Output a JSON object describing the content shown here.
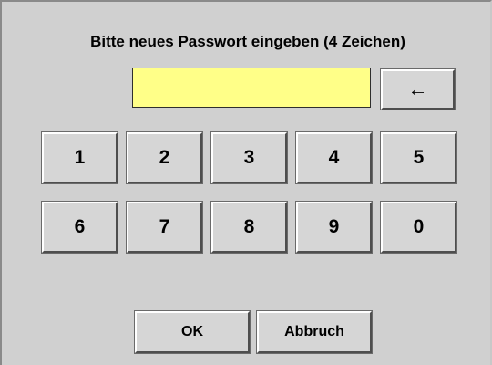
{
  "dialog": {
    "title": "Bitte neues Passwort eingeben (4 Zeichen)",
    "password_value": "",
    "backspace_label": "←"
  },
  "keypad": {
    "row1": [
      "1",
      "2",
      "3",
      "4",
      "5"
    ],
    "row2": [
      "6",
      "7",
      "8",
      "9",
      "0"
    ]
  },
  "actions": {
    "ok_label": "OK",
    "cancel_label": "Abbruch"
  },
  "colors": {
    "background": "#d0d0d0",
    "input_background": "#ffff88",
    "button_face": "#d6d6d6"
  }
}
